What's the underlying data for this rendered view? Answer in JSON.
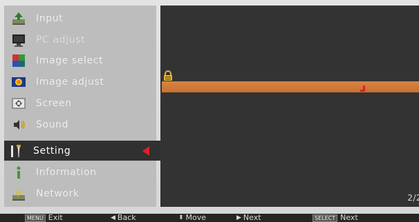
{
  "menu": {
    "items": [
      {
        "label": "Input",
        "icon": "input-icon"
      },
      {
        "label": "PC adjust",
        "icon": "pc-adjust-icon"
      },
      {
        "label": "Image select",
        "icon": "image-select-icon"
      },
      {
        "label": "Image adjust",
        "icon": "image-adjust-icon"
      },
      {
        "label": "Screen",
        "icon": "screen-icon"
      },
      {
        "label": "Sound",
        "icon": "sound-icon"
      },
      {
        "label": "Setting",
        "icon": "setting-icon"
      },
      {
        "label": "Information",
        "icon": "information-icon"
      },
      {
        "label": "Network",
        "icon": "network-icon"
      }
    ],
    "selected": "Setting"
  },
  "panel": {
    "page_indicator": "2/2"
  },
  "footer": {
    "exit_key": "MENU",
    "exit_label": "Exit",
    "back_label": "Back",
    "move_label": "Move",
    "next_label": "Next",
    "select_key": "SELECT",
    "select_next_label": "Next"
  },
  "colors": {
    "highlight": "#d98445",
    "panel_bg": "#333333",
    "sidebar_bg": "#bdbdbd",
    "active_bg": "#303030",
    "arrow": "#e02020"
  }
}
